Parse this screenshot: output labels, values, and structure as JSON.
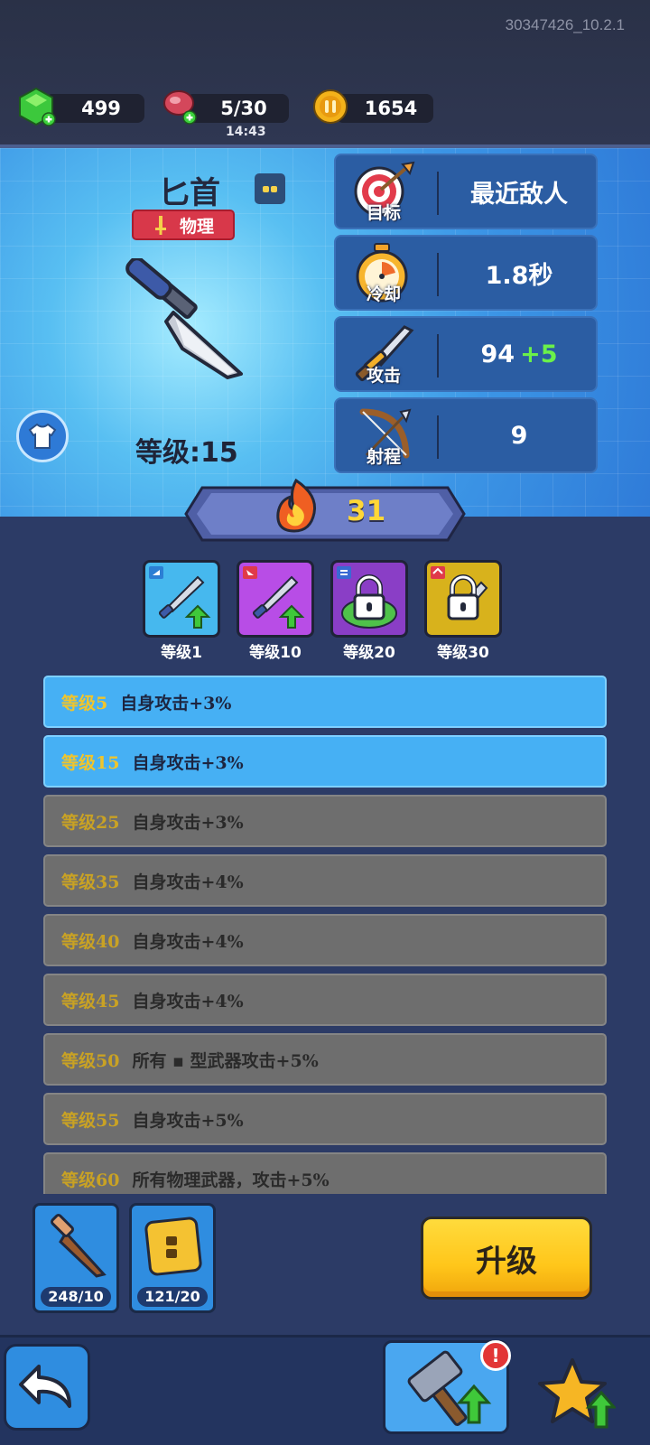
{
  "build": "30347426_10.2.1",
  "resources": {
    "gems": "499",
    "energy": "5/30",
    "energy_timer": "14:43",
    "coins": "1654"
  },
  "weapon": {
    "name": "匕首",
    "type_tag": "物理",
    "level_text": "等级:15"
  },
  "stats": [
    {
      "label": "目标",
      "value": "最近敌人",
      "bonus": ""
    },
    {
      "label": "冷却",
      "value": "1.8秒",
      "bonus": ""
    },
    {
      "label": "攻击",
      "value": "94",
      "bonus": "+5"
    },
    {
      "label": "射程",
      "value": "9",
      "bonus": ""
    }
  ],
  "star_value": "31",
  "evolutions": [
    {
      "label": "等级1",
      "color": "#46b8ee",
      "locked": false
    },
    {
      "label": "等级10",
      "color": "#b84de6",
      "locked": false
    },
    {
      "label": "等级20",
      "color": "#8a3ec6",
      "locked": true
    },
    {
      "label": "等级30",
      "color": "#d8b21c",
      "locked": true
    }
  ],
  "perks": [
    {
      "level": "等级5",
      "text": "自身攻击+3%",
      "active": true
    },
    {
      "level": "等级15",
      "text": "自身攻击+3%",
      "active": true
    },
    {
      "level": "等级25",
      "text": "自身攻击+3%",
      "active": false
    },
    {
      "level": "等级35",
      "text": "自身攻击+4%",
      "active": false
    },
    {
      "level": "等级40",
      "text": "自身攻击+4%",
      "active": false
    },
    {
      "level": "等级45",
      "text": "自身攻击+4%",
      "active": false
    },
    {
      "level": "等级50",
      "text": "所有 ▪ 型武器攻击+5%",
      "active": false
    },
    {
      "level": "等级55",
      "text": "自身攻击+5%",
      "active": false
    },
    {
      "level": "等级60",
      "text": "所有物理武器，攻击+5%",
      "active": false
    }
  ],
  "materials": [
    {
      "count": "248/10"
    },
    {
      "count": "121/20"
    }
  ],
  "upgrade_label": "升级",
  "forge_badge": "!"
}
